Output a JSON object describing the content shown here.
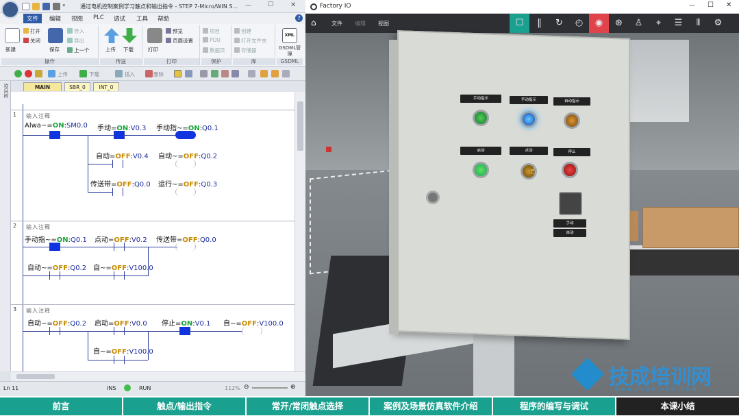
{
  "step7": {
    "window_title": "通过电机控制案例学习触点和输出指令 - STEP 7-Micro/WIN S...",
    "menu": [
      "文件",
      "编辑",
      "视图",
      "PLC",
      "调试",
      "工具",
      "帮助"
    ],
    "ribbon": {
      "groups": [
        {
          "label": "操作",
          "buttons": [
            "新建",
            "打开",
            "关闭",
            "保存",
            "导入",
            "导出",
            "上一个"
          ]
        },
        {
          "label": "传送",
          "buttons": [
            "上传",
            "下载"
          ]
        },
        {
          "label": "打印",
          "buttons": [
            "打印",
            "预览",
            "页面设置"
          ]
        },
        {
          "label": "保护",
          "buttons": [
            "项目",
            "POU",
            "数据页"
          ]
        },
        {
          "label": "库",
          "buttons": [
            "创建",
            "打开文件夹",
            "存储器"
          ]
        },
        {
          "label": "GSDML",
          "buttons": [
            "GSDML管理"
          ]
        }
      ]
    },
    "toolbar": {
      "upload": "上传",
      "download": "下载",
      "insert": "插入",
      "delete": "删除"
    },
    "sidebar_label": "项目树",
    "tabs": [
      "MAIN",
      "SBR_0",
      "INT_0"
    ],
    "networks": [
      {
        "num": "1",
        "comment": "输入注释",
        "row1": [
          {
            "name": "Alwa~",
            "state": "ON",
            "addr": "SM0.0"
          },
          {
            "name": "手动",
            "state": "ON",
            "addr": "V0.3"
          },
          {
            "name": "手动指~",
            "state": "ON",
            "addr": "Q0.1"
          }
        ],
        "row2": [
          {
            "name": "自动",
            "state": "OFF",
            "addr": "V0.4"
          },
          {
            "name": "自动~",
            "state": "OFF",
            "addr": "Q0.2"
          }
        ],
        "row3": [
          {
            "name": "传送带",
            "state": "OFF",
            "addr": "Q0.0"
          },
          {
            "name": "运行~",
            "state": "OFF",
            "addr": "Q0.3"
          }
        ]
      },
      {
        "num": "2",
        "comment": "输入注释",
        "row1": [
          {
            "name": "手动指~",
            "state": "ON",
            "addr": "Q0.1"
          },
          {
            "name": "点动",
            "state": "OFF",
            "addr": "V0.2"
          },
          {
            "name": "传送带",
            "state": "OFF",
            "addr": "Q0.0"
          }
        ],
        "row2": [
          {
            "name": "自动~",
            "state": "OFF",
            "addr": "Q0.2"
          },
          {
            "name": "自~",
            "state": "OFF",
            "addr": "V100.0"
          }
        ]
      },
      {
        "num": "3",
        "comment": "输入注释",
        "row1": [
          {
            "name": "自动~",
            "state": "OFF",
            "addr": "Q0.2"
          },
          {
            "name": "启动",
            "state": "OFF",
            "addr": "V0.0"
          },
          {
            "name": "停止",
            "state": "ON",
            "addr": "V0.1"
          },
          {
            "name": "自~",
            "state": "OFF",
            "addr": "V100.0"
          }
        ],
        "row2": [
          {
            "name": "自~",
            "state": "OFF",
            "addr": "V100.0"
          }
        ]
      }
    ],
    "status": {
      "line": "Ln 11",
      "mode": "INS",
      "run": "RUN",
      "zoom": "112%"
    }
  },
  "factoryio": {
    "title": "Factory IO",
    "menu": [
      "文件",
      "编辑",
      "视图"
    ],
    "toolbar_icons": [
      "square-icon",
      "pause-icon",
      "reset-icon",
      "timer-icon",
      "record-icon",
      "camera-icon",
      "walk-icon",
      "target-icon",
      "list-icon",
      "sensor-icon",
      "settings-icon"
    ],
    "panel_labels": [
      "手动指示",
      "手动指示",
      "自动指示",
      "启动",
      "点动",
      "停止",
      "手动",
      "自动"
    ]
  },
  "bottom_nav": [
    "前言",
    "触点/输出指令",
    "常开/常闭触点选择",
    "案例及场景仿真软件介绍",
    "程序的编写与调试",
    "本课小结"
  ],
  "watermark": {
    "title": "技成培训网",
    "url": "www.jcpeixun.com"
  },
  "colors": {
    "teal": "#1aa08f",
    "dark": "#222222",
    "highlight": "#1034e0",
    "on": "#19a33a",
    "off": "#c78a00"
  }
}
